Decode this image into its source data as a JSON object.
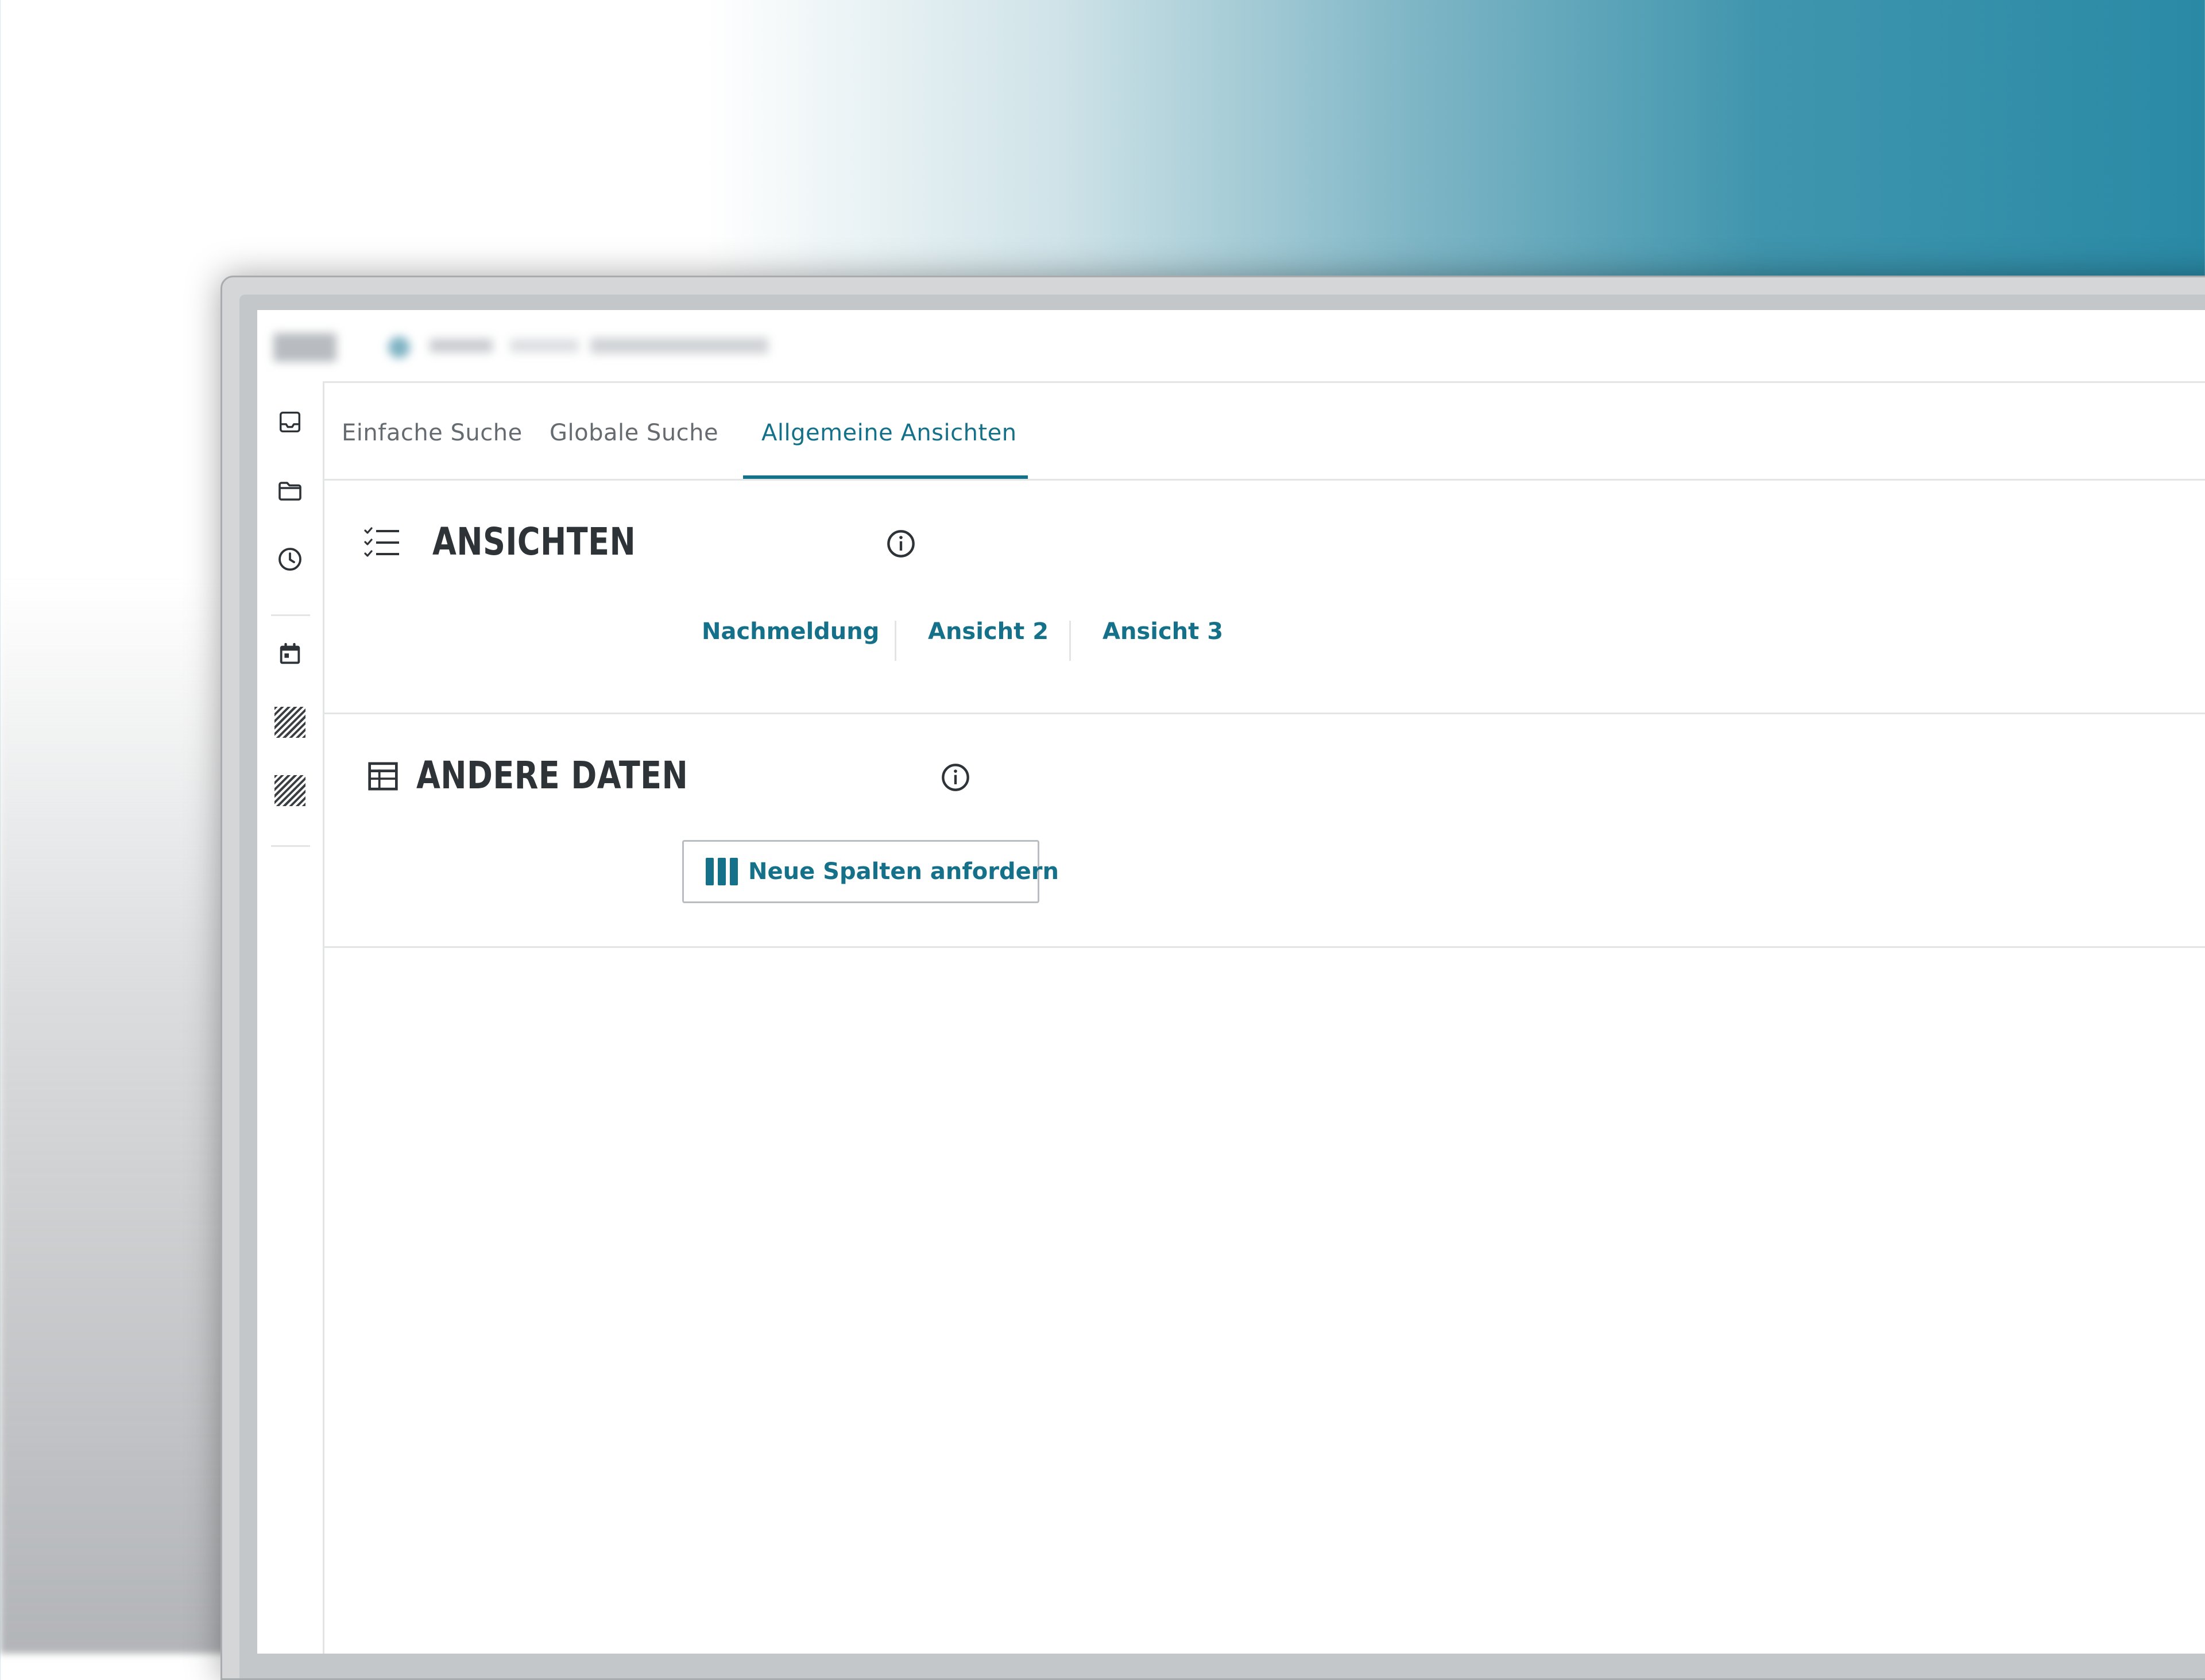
{
  "tabs": [
    {
      "label": "Einfache Suche"
    },
    {
      "label": "Globale Suche"
    },
    {
      "label": "Allgemeine Ansichten"
    }
  ],
  "ansichten": {
    "title": "ANSICHTEN",
    "views": [
      {
        "label": "Nachmeldung"
      },
      {
        "label": "Ansicht 2"
      },
      {
        "label": "Ansicht 3"
      }
    ]
  },
  "andere_daten": {
    "title": "ANDERE DATEN",
    "request_button": "Neue Spalten anfordern"
  },
  "colors": {
    "accent": "#15718a",
    "text_dark": "#2e3338",
    "text_muted": "#666b70",
    "divider": "#e2e4e6"
  }
}
